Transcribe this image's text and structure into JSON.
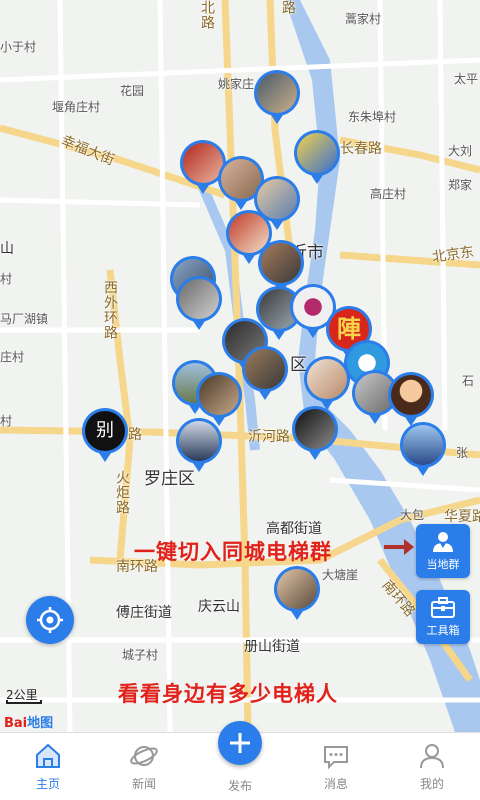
{
  "map": {
    "labels": {
      "beilu": "北路",
      "lu_top": "路",
      "yaojiazhuang": "姚家庄",
      "hongjiacun": "蒿家村",
      "xiaoyucun": "小于村",
      "huayuan": "花园",
      "yanzhuangcun": "堰角庄村",
      "dongzhuliucun": "东朱埠村",
      "dazhuang": "太平",
      "daliu": "大刘",
      "zhengjia": "郑家",
      "xingfu_dajie": "幸福大街",
      "changchun_lu": "长春路",
      "gaozhuangcun": "高庄村",
      "linyi_shi": "沂市",
      "beijing_dong": "北京东",
      "shan": "山",
      "xiwaihuan_lu": "西外环路",
      "ma_changhu": "马厂湖镇",
      "zhuang_cun": "庄村",
      "qu": "区",
      "shi": "石",
      "yihe_lu": "沂河路",
      "zhang": "张",
      "luozhuang_qu": "罗庄区",
      "huoju_lu": "火炬路",
      "gaodu_jiedao": "高都街道",
      "dabao": "大包",
      "huaxia_lu": "华夏路",
      "datangya": "大塘崖",
      "nanhuan_lu_left": "南环路",
      "nanhuan_lu_right": "南环路",
      "fuzhuang_jiedao": "傅庄街道",
      "qingyunshan": "庆云山",
      "cezhuang_jiedao": "册山街道",
      "chengzicun": "城子村",
      "cun_left1": "村",
      "cun_left2": "村",
      "lu_mid": "路"
    },
    "pins_count": 22
  },
  "cta": {
    "switch_group": "一键切入同城电梯群",
    "see_nearby": "看看身边有多少电梯人"
  },
  "side_buttons": {
    "local_group": "当地群",
    "toolbox": "工具箱"
  },
  "scale": {
    "label": "2公里"
  },
  "logo": {
    "part1": "Bai",
    "part2": "地图"
  },
  "tabs": [
    {
      "label": "主页",
      "icon": "home-icon",
      "active": true
    },
    {
      "label": "新闻",
      "icon": "planet-icon",
      "active": false
    },
    {
      "label": "发布",
      "icon": "plus-icon",
      "active": false
    },
    {
      "label": "消息",
      "icon": "message-icon",
      "active": false
    },
    {
      "label": "我的",
      "icon": "user-icon",
      "active": false
    }
  ],
  "colors": {
    "accent": "#2b7de9",
    "cta": "#e0221b",
    "river": "#a9c8f0",
    "road_major": "#f7d88c"
  }
}
